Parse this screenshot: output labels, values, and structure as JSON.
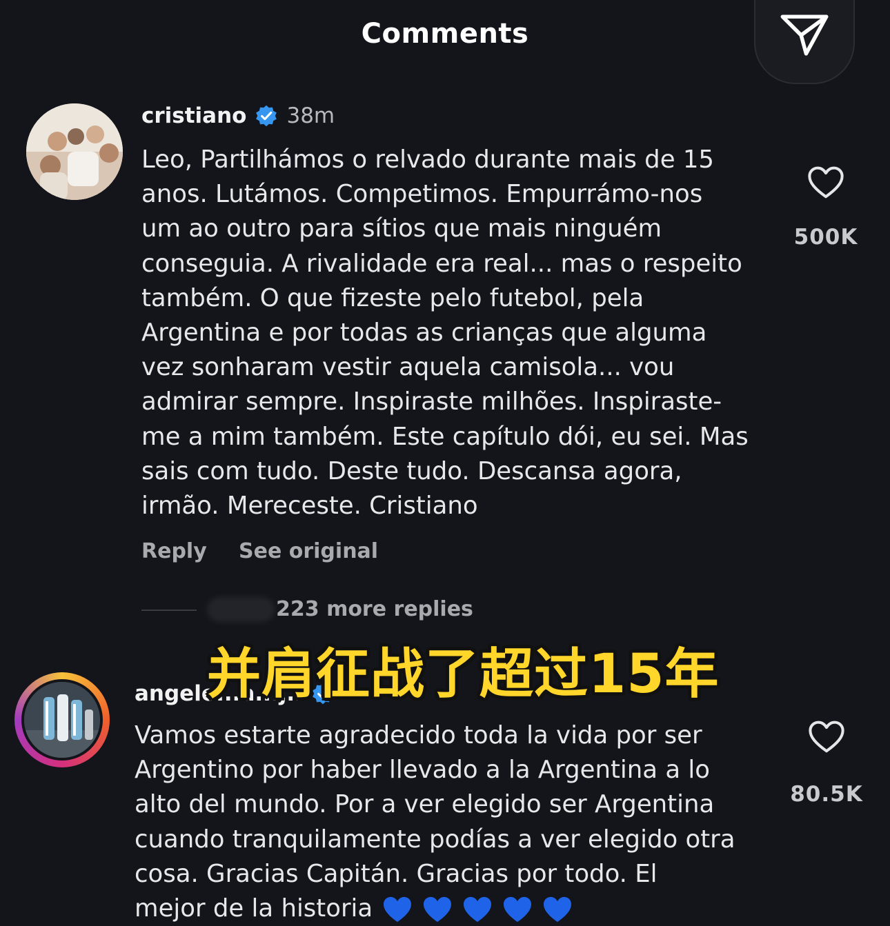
{
  "header": {
    "title": "Comments"
  },
  "comments": [
    {
      "username": "cristiano",
      "verified": true,
      "time": "38m",
      "text": "Leo, Partilhámos o relvado durante mais de 15\nanos. Lutámos. Competimos. Empurrámo-nos\num ao outro para sítios que mais ninguém\nconseguia. A rivalidade era real... mas o respeito\ntambém. O que fizeste pelo futebol, pela\nArgentina e por todas as crianças que alguma\nvez sonharam vestir aquela camisola... vou\nadmirar sempre. Inspiraste milhões. Inspiraste-\nme a mim também. Este capítulo dói, eu sei. Mas\nsais com tudo. Deste tudo. Descansa agora,\nirmão. Mereceste. Cristiano",
      "likes": "500K",
      "reply_label": "Reply",
      "see_original_label": "See original",
      "more_replies": "223 more replies"
    },
    {
      "username": "angeldimariajm",
      "username_visible": "angelo...a...j..",
      "verified": true,
      "text": "Vamos estarte agradecido toda la vida por ser\nArgentino por haber llevado a la Argentina a lo\nalto del mundo. Por a ver elegido ser Argentina\ncuando tranquilamente podías a ver elegido otra\ncosa. Gracias Capitán. Gracias por todo. El\nmejor de la historia",
      "emoji": "💙💙💙💙💙",
      "likes": "80.5K"
    }
  ],
  "overlay_subtitle": "并肩征战了超过15年",
  "icons": {
    "share": "paper-plane-icon",
    "like": "heart-outline-icon",
    "verified": "verified-badge-icon"
  },
  "colors": {
    "background": "#14151b",
    "verified": "#3797f0",
    "subtitle": "#ffd629",
    "emoji_heart": "#1f63e8"
  }
}
